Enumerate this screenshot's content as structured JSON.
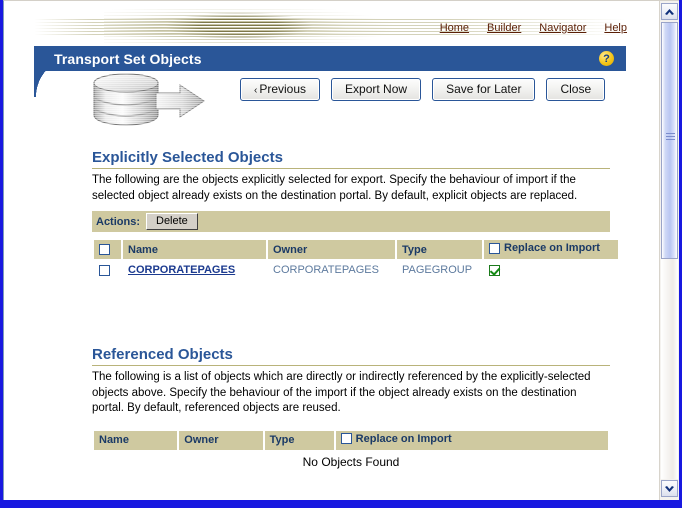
{
  "window": {
    "scrollbar": {
      "up_arrow": "scroll-up",
      "down_arrow": "scroll-down"
    }
  },
  "global_nav": [
    {
      "label": "Home"
    },
    {
      "label": "Builder"
    },
    {
      "label": "Navigator"
    },
    {
      "label": "Help"
    }
  ],
  "header": {
    "title": "Transport Set Objects",
    "help_icon": "?",
    "brand_alt": "portal-logo"
  },
  "toolbar": {
    "previous_label": "Previous",
    "previous_chevron": "‹",
    "export_now_label": "Export Now",
    "save_for_later_label": "Save for Later",
    "close_label": "Close"
  },
  "explicit_section": {
    "title": "Explicitly Selected Objects",
    "description": "The following are the objects explicitly selected for export. Specify the behaviour of import if the selected object already exists on the destination portal. By default, explicit objects are replaced.",
    "actions_label": "Actions:",
    "delete_label": "Delete",
    "columns": [
      "Name",
      "Owner",
      "Type",
      "Replace on Import"
    ],
    "rows": [
      {
        "selected": false,
        "name": "CORPORATEPAGES",
        "owner": "CORPORATEPAGES",
        "type": "PAGEGROUP",
        "replace_on_import": true
      }
    ]
  },
  "referenced_section": {
    "title": "Referenced Objects",
    "description": "The following is a list of objects which are directly or indirectly referenced by the explicitly-selected objects above. Specify the behaviour of the import if the object already exists on the destination portal. By default, referenced objects are reused.",
    "columns": [
      "Name",
      "Owner",
      "Type",
      "Replace on Import"
    ],
    "empty_message": "No Objects Found"
  },
  "colors": {
    "title_bar_blue": "#2a5698",
    "table_header_khaki": "#cfc9a0",
    "link_maroon": "#5b1f06",
    "heading_blue": "#2a5698",
    "check_green": "#138a13",
    "window_frame_blue": "#1818e0"
  }
}
